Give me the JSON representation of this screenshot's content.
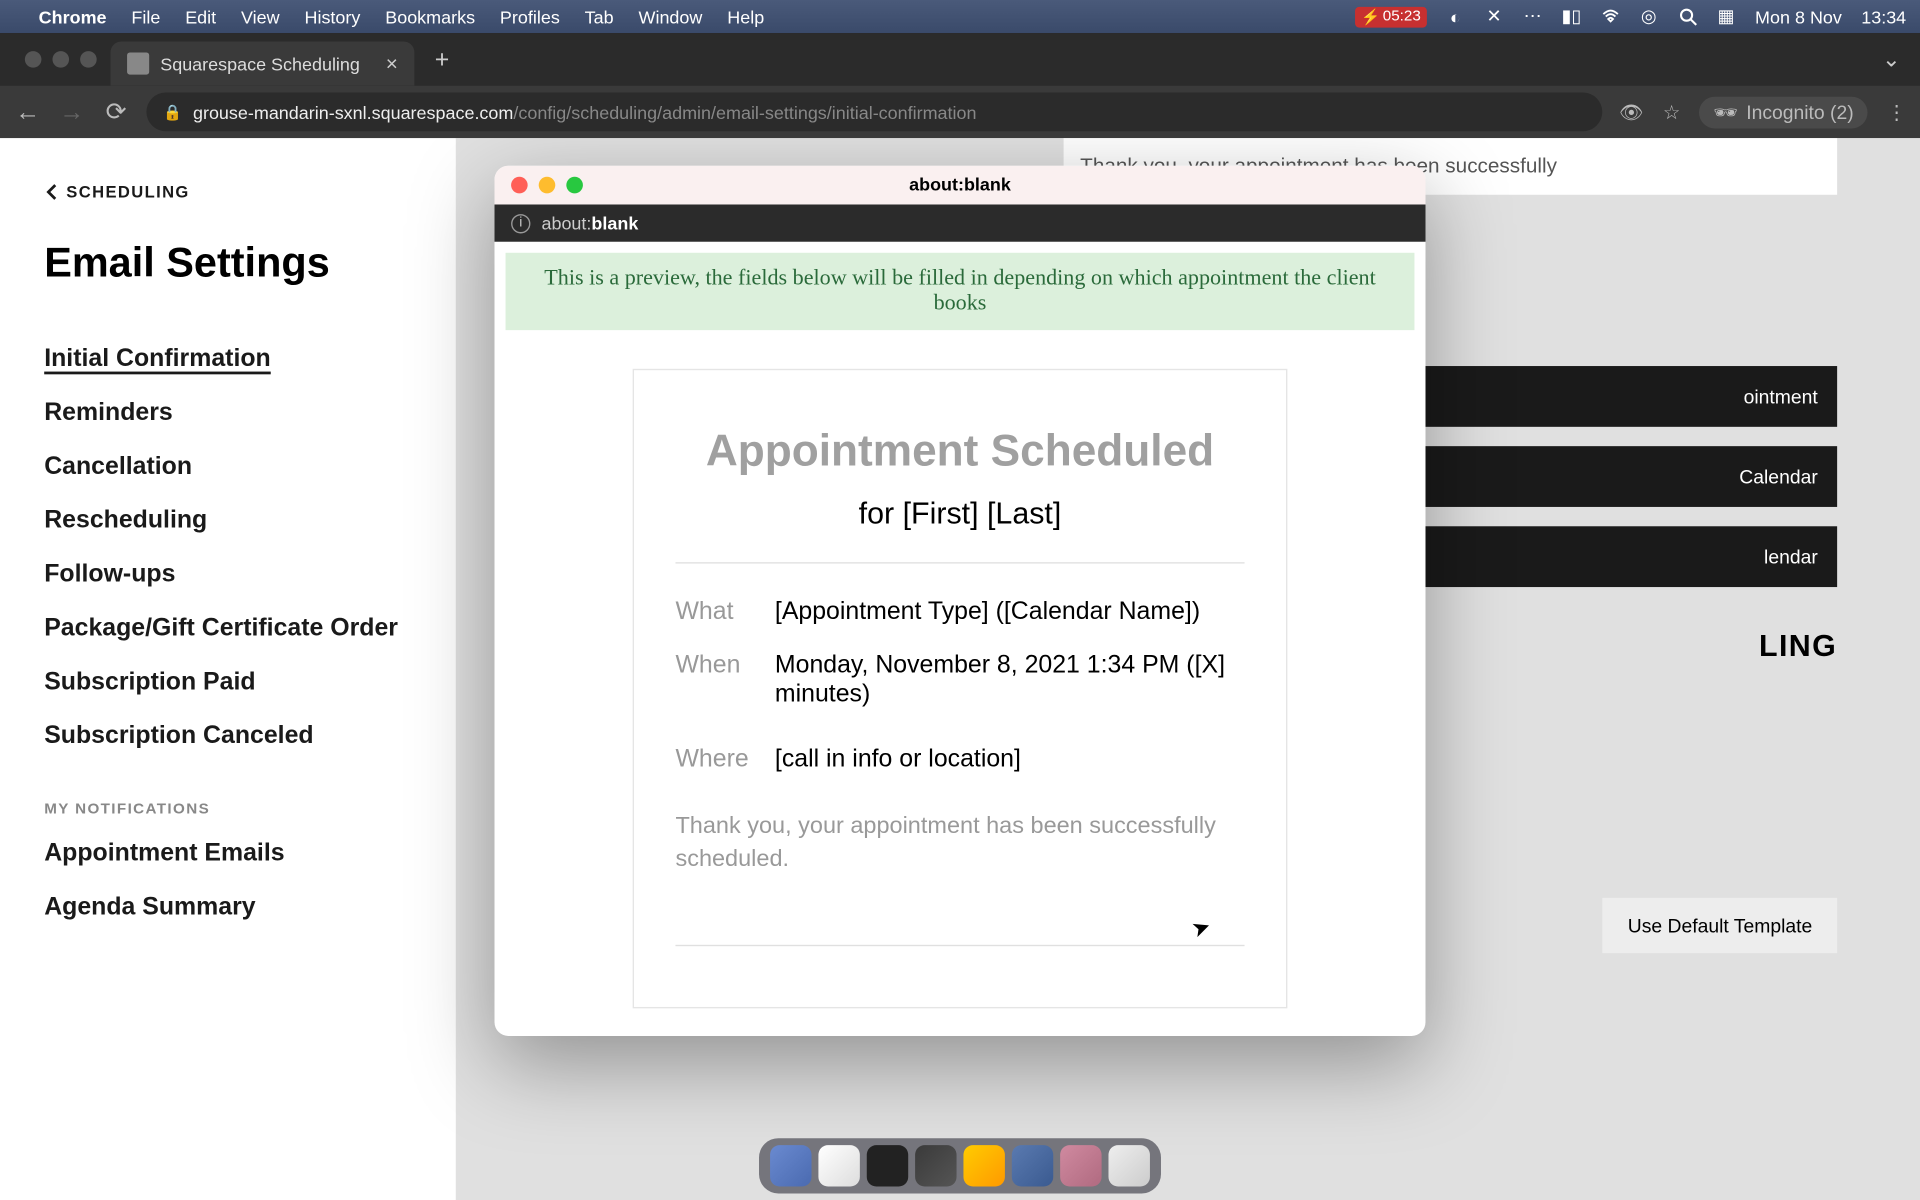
{
  "menubar": {
    "app": "Chrome",
    "items": [
      "File",
      "Edit",
      "View",
      "History",
      "Bookmarks",
      "Profiles",
      "Tab",
      "Window",
      "Help"
    ],
    "battery_time": "05:23",
    "date": "Mon 8 Nov",
    "time": "13:34"
  },
  "browser": {
    "tab_title": "Squarespace Scheduling",
    "url_host": "grouse-mandarin-sxnl.squarespace.com",
    "url_path": "/config/scheduling/admin/email-settings/initial-confirmation",
    "incognito_label": "Incognito (2)"
  },
  "sidebar": {
    "back_label": "SCHEDULING",
    "page_title": "Email Settings",
    "items": [
      {
        "label": "Initial Confirmation",
        "active": true
      },
      {
        "label": "Reminders"
      },
      {
        "label": "Cancellation"
      },
      {
        "label": "Rescheduling"
      },
      {
        "label": "Follow-ups"
      },
      {
        "label": "Package/Gift Certificate Order"
      },
      {
        "label": "Subscription Paid"
      },
      {
        "label": "Subscription Canceled"
      }
    ],
    "section_label": "MY NOTIFICATIONS",
    "notif_items": [
      {
        "label": "Appointment Emails"
      },
      {
        "label": "Agenda Summary"
      }
    ]
  },
  "background": {
    "card_text": "Thank you, your appointment has been successfully",
    "btn1": "ointment",
    "btn2": "Calendar",
    "btn3": "lendar",
    "heading_partial": "LING",
    "default_btn": "Use Default Template"
  },
  "popup": {
    "title": "about:blank",
    "addr_prefix": "about:",
    "addr_bold": "blank",
    "banner": "This is a preview, the fields below will be filled in depending on which appointment the client books",
    "heading": "Appointment Scheduled",
    "for_line": "for [First] [Last]",
    "rows": {
      "what_label": "What",
      "what_val": "[Appointment Type] ([Calendar Name])",
      "when_label": "When",
      "when_val": "Monday, November 8, 2021 1:34 PM ([X] minutes)",
      "where_label": "Where",
      "where_val": "[call in info or location]"
    },
    "thanks": "Thank you, your appointment has been successfully scheduled."
  }
}
